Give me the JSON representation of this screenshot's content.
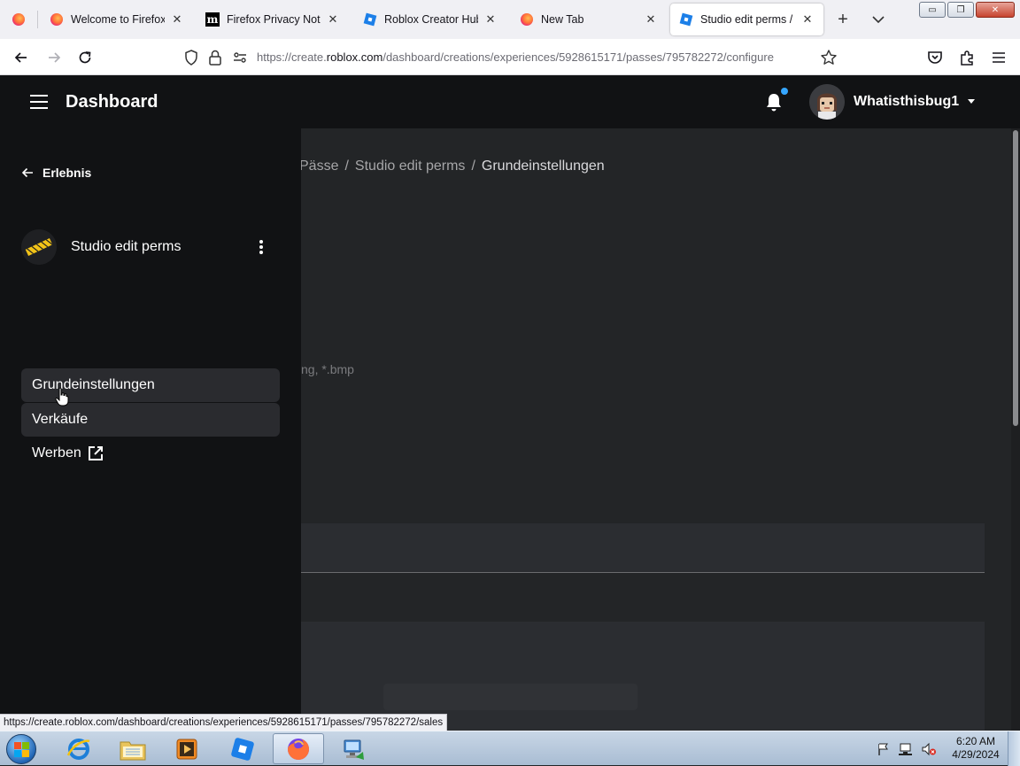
{
  "browser": {
    "tabs": [
      {
        "title": "Welcome to Firefox",
        "icon": "firefox-icon",
        "active": false
      },
      {
        "title": "Firefox Privacy Notice",
        "icon": "mozilla-icon",
        "active": false
      },
      {
        "title": "Roblox Creator Hub",
        "icon": "roblox-icon",
        "active": false
      },
      {
        "title": "New Tab",
        "icon": "firefox-icon",
        "active": false
      },
      {
        "title": "Studio edit perms / Gru",
        "icon": "roblox-icon",
        "active": true
      }
    ],
    "url_prefix": "https://create.",
    "url_host": "roblox.com",
    "url_path": "/dashboard/creations/experiences/5928615171/passes/795782272/configure",
    "status_link": "https://create.roblox.com/dashboard/creations/experiences/5928615171/passes/795782272/sales"
  },
  "topbar": {
    "title": "Dashboard",
    "username": "Whatisthisbug1",
    "notification_dot_color": "#35a6ff"
  },
  "breadcrumb": {
    "items": [
      "Pässe",
      "Studio edit perms",
      "Grundeinstellungen"
    ],
    "separator": "/"
  },
  "content": {
    "file_hint": "ng, *.bmp"
  },
  "sidebar": {
    "back_label": "Erlebnis",
    "experience_title": "Studio edit perms",
    "nav": [
      {
        "label": "Grundeinstellungen",
        "selected": true
      },
      {
        "label": "Verkäufe",
        "selected": false
      },
      {
        "label": "Werben",
        "external": true
      }
    ]
  },
  "taskbar": {
    "time": "6:20 AM",
    "date": "4/29/2024"
  },
  "colors": {
    "page_bg": "#232527",
    "topbar_bg": "#111214",
    "accent": "#35a6ff"
  }
}
